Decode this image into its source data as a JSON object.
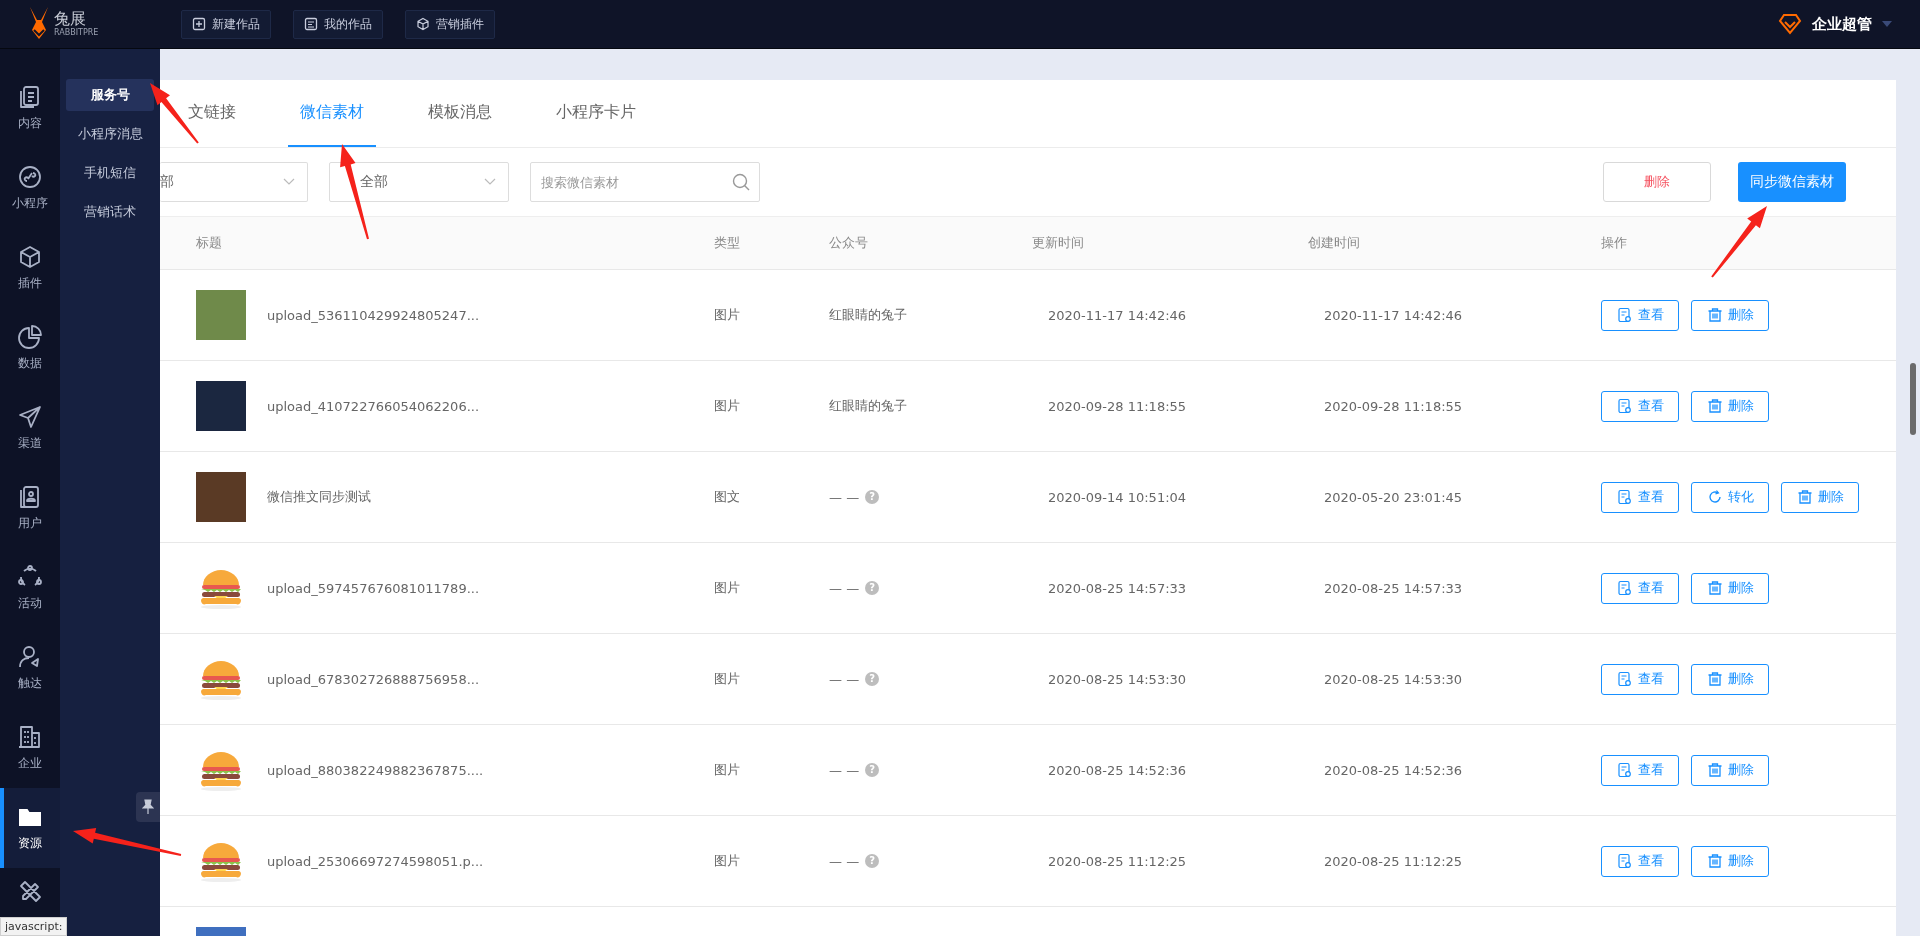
{
  "top_bar": {
    "logo": {
      "name": "兔展",
      "tagline": "RABBITPRE"
    },
    "buttons": [
      {
        "kind": "new",
        "label": "新建作品"
      },
      {
        "kind": "mine",
        "label": "我的作品"
      },
      {
        "kind": "plugin",
        "label": "营销插件"
      }
    ],
    "account": "企业超管"
  },
  "rail": [
    {
      "label": "内容",
      "selected": false
    },
    {
      "label": "小程序",
      "selected": false
    },
    {
      "label": "插件",
      "selected": false
    },
    {
      "label": "数据",
      "selected": false
    },
    {
      "label": "渠道",
      "selected": false
    },
    {
      "label": "用户",
      "selected": false
    },
    {
      "label": "活动",
      "selected": false
    },
    {
      "label": "触达",
      "selected": false
    },
    {
      "label": "企业",
      "selected": false
    },
    {
      "label": "资源",
      "selected": true
    },
    {
      "selected": false
    }
  ],
  "submenu": [
    {
      "label": "服务号",
      "selected": true
    },
    {
      "label": "小程序消息",
      "selected": false
    },
    {
      "label": "手机短信",
      "selected": false
    },
    {
      "label": "营销话术",
      "selected": false
    }
  ],
  "tabs": [
    {
      "label": "文链接",
      "selected": false
    },
    {
      "label": "微信素材",
      "selected": true
    },
    {
      "label": "模板消息",
      "selected": false
    },
    {
      "label": "小程序卡片",
      "selected": false
    }
  ],
  "filters": {
    "dropdowns": [
      {
        "value": "部"
      },
      {
        "value": "全部"
      }
    ],
    "search": {
      "placeholder": "搜索微信素材"
    },
    "delete_button": "删除",
    "sync_button": "同步微信素材"
  },
  "table": {
    "columns": [
      "标题",
      "类型",
      "公众号",
      "更新时间",
      "创建时间",
      "操作"
    ],
    "rows": [
      {
        "thumbnail": {
          "kind": "photo"
        },
        "title": "upload_536110429924805247...",
        "type": "图片",
        "account": "红眼睛的兔子",
        "updated": "2020-11-17 14:42:46",
        "created": "2020-11-17 14:42:46",
        "actions": [
          {
            "kind": "view",
            "label": "查看"
          },
          {
            "kind": "delete",
            "label": "删除"
          }
        ]
      },
      {
        "thumbnail": {
          "kind": "photo"
        },
        "title": "upload_410722766054062206...",
        "type": "图片",
        "account": "红眼睛的兔子",
        "updated": "2020-09-28 11:18:55",
        "created": "2020-09-28 11:18:55",
        "actions": [
          {
            "kind": "view",
            "label": "查看"
          },
          {
            "kind": "delete",
            "label": "删除"
          }
        ]
      },
      {
        "thumbnail": {
          "kind": "photo"
        },
        "title": "微信推文同步测试",
        "type": "图文",
        "account": "— —",
        "help": "?",
        "updated": "2020-09-14 10:51:04",
        "created": "2020-05-20 23:01:45",
        "actions": [
          {
            "kind": "view",
            "label": "查看"
          },
          {
            "kind": "convert",
            "label": "转化"
          },
          {
            "kind": "delete",
            "label": "删除"
          }
        ]
      },
      {
        "thumbnail": {
          "kind": "burger"
        },
        "title": "upload_597457676081011789...",
        "type": "图片",
        "account": "— —",
        "help": "?",
        "updated": "2020-08-25 14:57:33",
        "created": "2020-08-25 14:57:33",
        "actions": [
          {
            "kind": "view",
            "label": "查看"
          },
          {
            "kind": "delete",
            "label": "删除"
          }
        ]
      },
      {
        "thumbnail": {
          "kind": "burger"
        },
        "title": "upload_678302726888756958...",
        "type": "图片",
        "account": "— —",
        "help": "?",
        "updated": "2020-08-25 14:53:30",
        "created": "2020-08-25 14:53:30",
        "actions": [
          {
            "kind": "view",
            "label": "查看"
          },
          {
            "kind": "delete",
            "label": "删除"
          }
        ]
      },
      {
        "thumbnail": {
          "kind": "burger"
        },
        "title": "upload_880382249882367875....",
        "type": "图片",
        "account": "— —",
        "help": "?",
        "updated": "2020-08-25 14:52:36",
        "created": "2020-08-25 14:52:36",
        "actions": [
          {
            "kind": "view",
            "label": "查看"
          },
          {
            "kind": "delete",
            "label": "删除"
          }
        ]
      },
      {
        "thumbnail": {
          "kind": "burger"
        },
        "title": "upload_25306697274598051.p...",
        "type": "图片",
        "account": "— —",
        "help": "?",
        "updated": "2020-08-25 11:12:25",
        "created": "2020-08-25 11:12:25",
        "actions": [
          {
            "kind": "view",
            "label": "查看"
          },
          {
            "kind": "delete",
            "label": "删除"
          }
        ]
      },
      {
        "thumbnail": {
          "kind": "photo"
        }
      }
    ]
  },
  "status_text": "javascript:"
}
